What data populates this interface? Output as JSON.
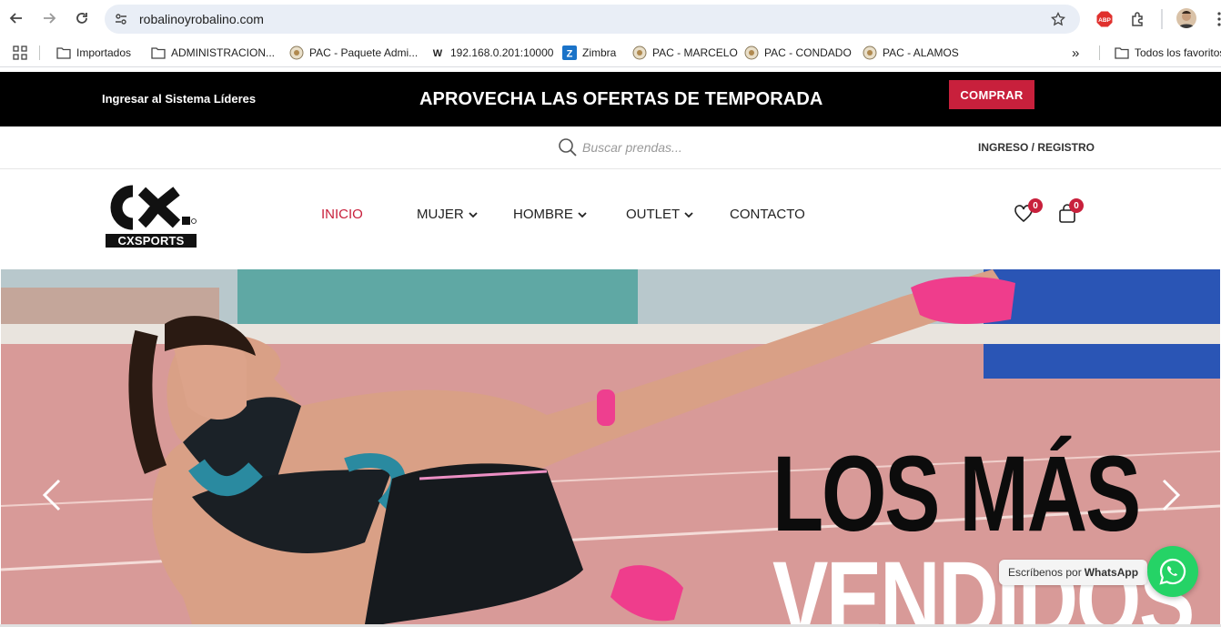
{
  "browser": {
    "url": "robalinoyrobalino.com",
    "bookmarks": [
      {
        "label": "Importados",
        "icon": "folder-icon"
      },
      {
        "label": "ADMINISTRACION...",
        "icon": "folder-icon"
      },
      {
        "label": "PAC - Paquete Admi...",
        "icon": "pac-icon"
      },
      {
        "label": "192.168.0.201:10000",
        "icon": "webmin-icon"
      },
      {
        "label": "Zimbra",
        "icon": "zimbra-icon"
      },
      {
        "label": "PAC - MARCELO",
        "icon": "pac-icon"
      },
      {
        "label": "PAC - CONDADO",
        "icon": "pac-icon"
      },
      {
        "label": "PAC - ALAMOS",
        "icon": "pac-icon"
      }
    ],
    "more": "»",
    "all_bookmarks": "Todos los favoritos",
    "adblock_label": "ABP"
  },
  "promo": {
    "lideres": "Ingresar al Sistema Líderes",
    "headline": "APROVECHA LAS OFERTAS DE TEMPORADA",
    "cta": "COMPRAR"
  },
  "search": {
    "placeholder": "Buscar prendas...",
    "login": "INGRESO / REGISTRO"
  },
  "brand": {
    "logo_top": "CX.",
    "logo_bottom": "CXSPORTS",
    "accent": "#c8203c"
  },
  "menu": {
    "inicio": "INICIO",
    "mujer": "MUJER",
    "hombre": "HOMBRE",
    "outlet": "OUTLET",
    "contacto": "CONTACTO"
  },
  "counters": {
    "wishlist": "0",
    "cart": "0"
  },
  "hero": {
    "line1": "LOS MÁS",
    "line2": "VENDIDOS"
  },
  "whatsapp": {
    "prefix": "Escríbenos por",
    "brand": "WhatsApp"
  }
}
